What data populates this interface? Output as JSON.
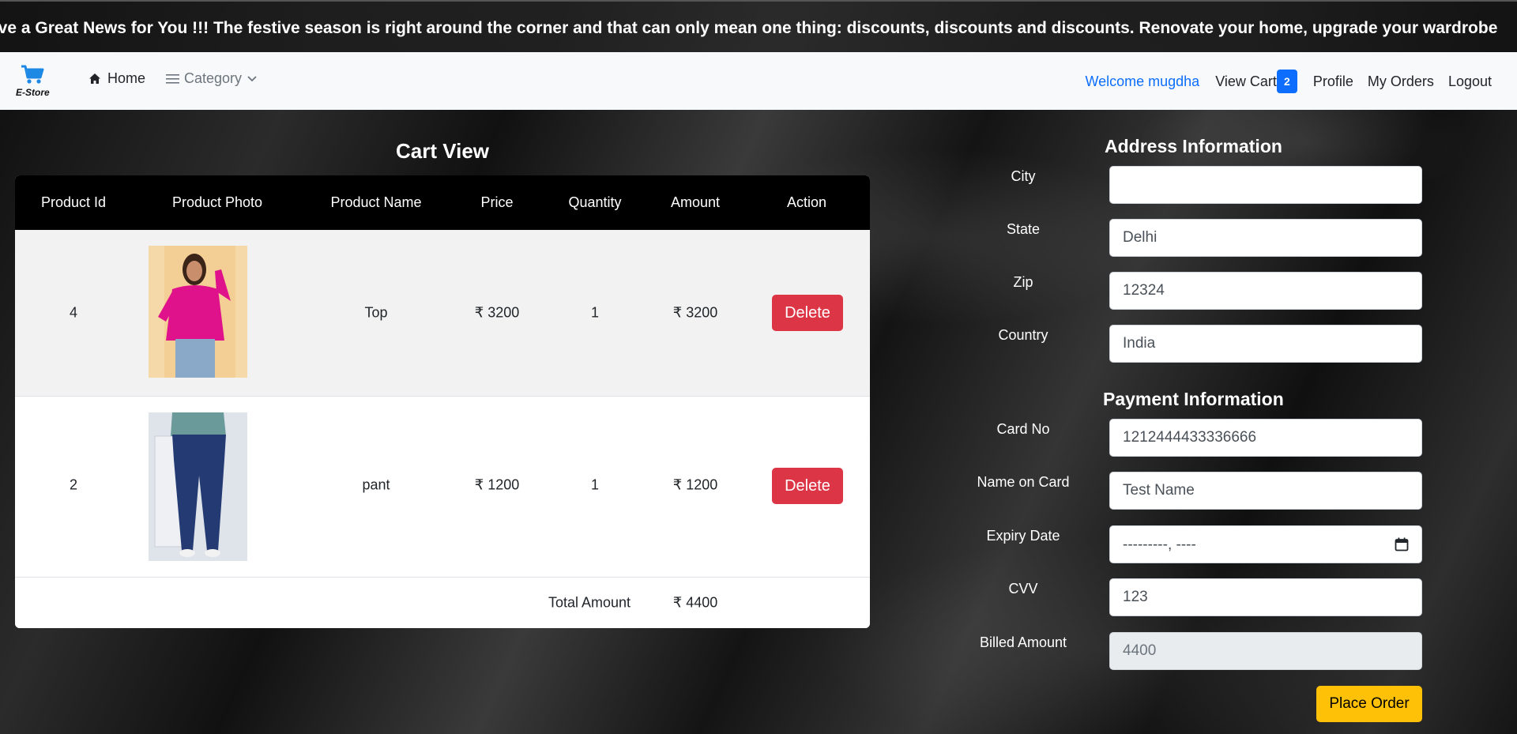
{
  "marquee": {
    "text": "ave a Great News for You !!! The festive season is right around the corner and that can only mean one thing: discounts, discounts and discounts. Renovate your home, upgrade your wardrobe"
  },
  "navbar": {
    "brand": "E-Store",
    "home": "Home",
    "category": "Category",
    "welcome": "Welcome mugdha",
    "view_cart": "View Cart",
    "cart_count": "2",
    "profile": "Profile",
    "my_orders": "My Orders",
    "logout": "Logout",
    "icons": [
      "cart-icon",
      "home-icon",
      "menu-icon",
      "chevron-down-icon"
    ]
  },
  "cart": {
    "title": "Cart View",
    "headers": [
      "Product Id",
      "Product Photo",
      "Product Name",
      "Price",
      "Quantity",
      "Amount",
      "Action"
    ],
    "rows": [
      {
        "id": "4",
        "name": "Top",
        "price": "₹ 3200",
        "quantity": "1",
        "amount": "₹ 3200",
        "action": "Delete"
      },
      {
        "id": "2",
        "name": "pant",
        "price": "₹ 1200",
        "quantity": "1",
        "amount": "₹ 1200",
        "action": "Delete"
      }
    ],
    "total_label": "Total Amount",
    "total_value": "₹ 4400"
  },
  "address": {
    "title": "Address Information",
    "city_label": "City",
    "city_value": "",
    "state_label": "State",
    "state_value": "Delhi",
    "zip_label": "Zip",
    "zip_value": "12324",
    "country_label": "Country",
    "country_value": "India"
  },
  "payment": {
    "title": "Payment Information",
    "card_label": "Card No",
    "card_value": "1212444433336666",
    "name_label": "Name on Card",
    "name_value": "Test Name",
    "expiry_label": "Expiry Date",
    "expiry_placeholder": "---------, ----",
    "cvv_label": "CVV",
    "cvv_value": "123",
    "billed_label": "Billed Amount",
    "billed_value": "4400",
    "submit": "Place Order"
  },
  "colors": {
    "primary": "#0d6efd",
    "danger": "#dc3545",
    "warning": "#ffc107",
    "navbar_bg": "#f8f9fa"
  }
}
